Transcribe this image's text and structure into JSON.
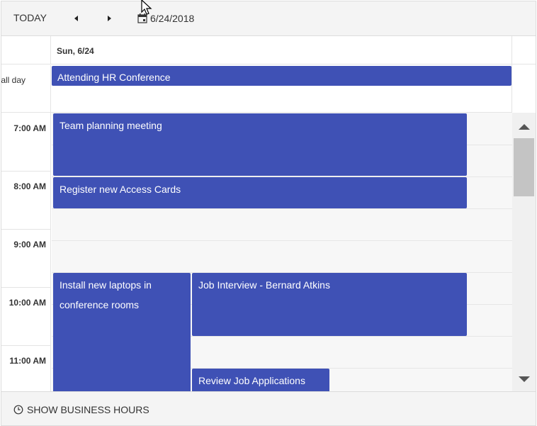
{
  "toolbar": {
    "today_label": "TODAY",
    "date_value": "6/24/2018"
  },
  "header": {
    "day_label": "Sun, 6/24"
  },
  "all_day": {
    "label": "all day",
    "event": "Attending HR Conference"
  },
  "times": [
    "7:00 AM",
    "8:00 AM",
    "9:00 AM",
    "10:00 AM",
    "11:00 AM"
  ],
  "events": {
    "team_planning": "Team planning meeting",
    "access_cards": "Register new Access Cards",
    "install_laptops_line1": "Install new laptops in",
    "install_laptops_line2": "conference rooms",
    "job_interview": "Job Interview - Bernard Atkins",
    "review_applications": "Review Job Applications"
  },
  "footer": {
    "business_hours_label": "SHOW BUSINESS HOURS"
  },
  "colors": {
    "event_accent": "#3f51b5",
    "toolbar_bg": "#f4f4f4",
    "slot_bg": "#f7f7f7"
  },
  "icons": [
    "chevron-left-icon",
    "chevron-right-icon",
    "calendar-icon",
    "mouse-cursor-icon",
    "clock-icon",
    "scroll-up-icon",
    "scroll-down-icon"
  ]
}
